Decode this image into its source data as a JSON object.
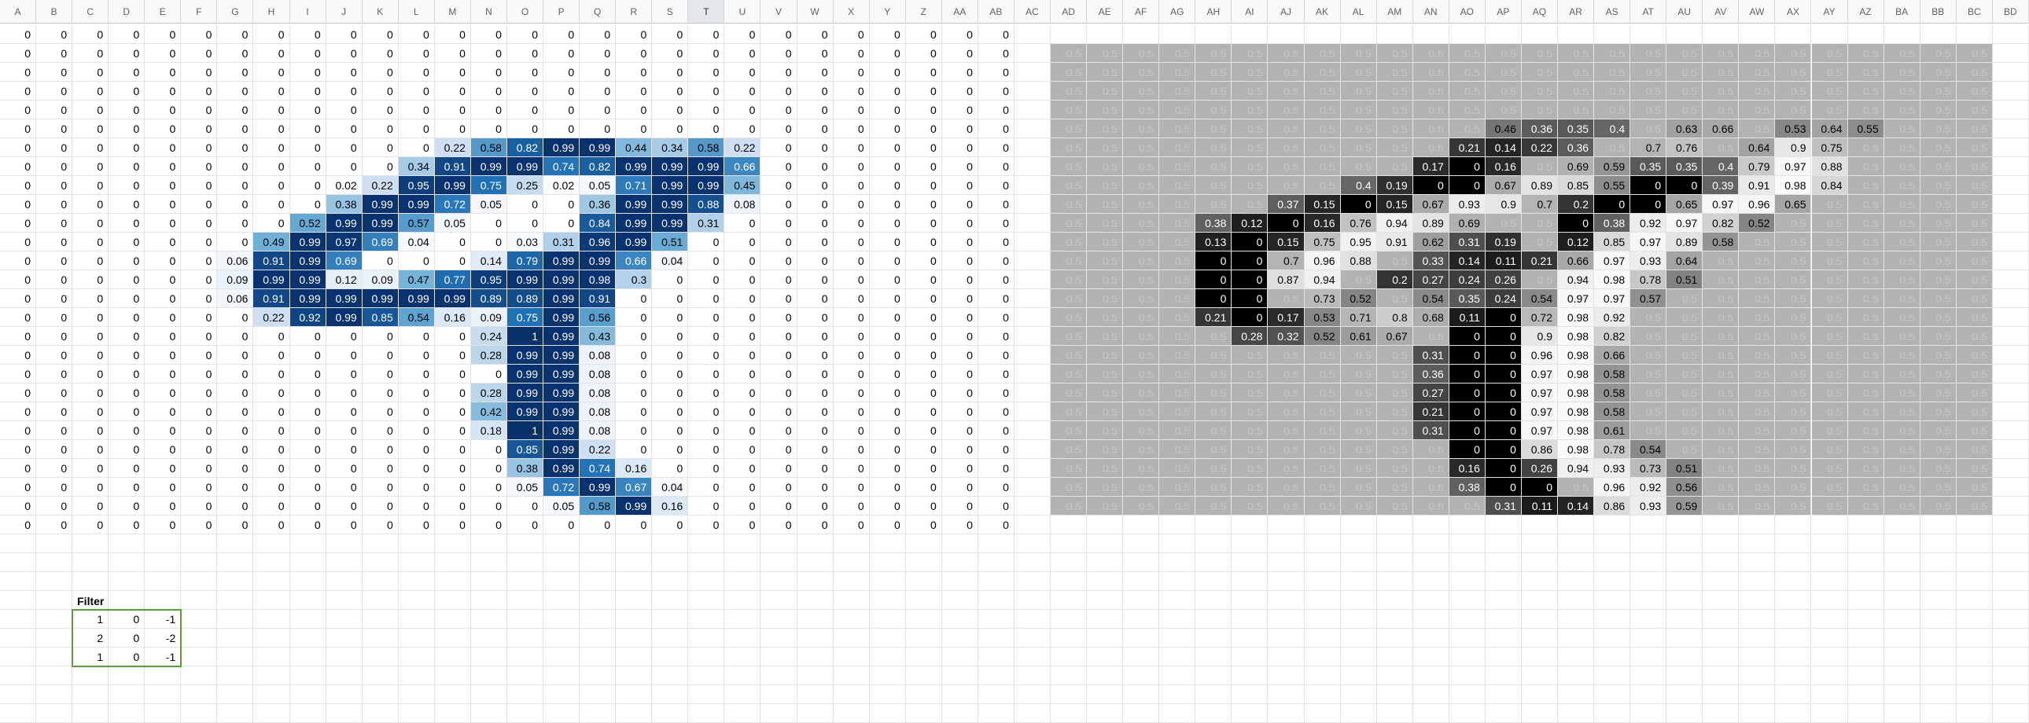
{
  "columns": [
    "A",
    "B",
    "C",
    "D",
    "E",
    "F",
    "G",
    "H",
    "I",
    "J",
    "K",
    "L",
    "M",
    "N",
    "O",
    "P",
    "Q",
    "R",
    "S",
    "T",
    "U",
    "V",
    "W",
    "X",
    "Y",
    "Z",
    "AA",
    "AB",
    "AC",
    "AD",
    "AE",
    "AF",
    "AG",
    "AH",
    "AI",
    "AJ",
    "AK",
    "AL",
    "AM",
    "AN",
    "AO",
    "AP",
    "AQ",
    "AR",
    "AS",
    "AT",
    "AU",
    "AV",
    "AW",
    "AX",
    "AY",
    "AZ",
    "BA",
    "BB",
    "BC",
    "BD"
  ],
  "selected_column": "T",
  "image_rows": [
    [
      0,
      0,
      0,
      0,
      0,
      0,
      0,
      0,
      0,
      0,
      0,
      0,
      0,
      0,
      0,
      0,
      0,
      0,
      0,
      0,
      0,
      0,
      0,
      0,
      0,
      0,
      0,
      0
    ],
    [
      0,
      0,
      0,
      0,
      0,
      0,
      0,
      0,
      0,
      0,
      0,
      0,
      0,
      0,
      0,
      0,
      0,
      0,
      0,
      0,
      0,
      0,
      0,
      0,
      0,
      0,
      0,
      0
    ],
    [
      0,
      0,
      0,
      0,
      0,
      0,
      0,
      0,
      0,
      0,
      0,
      0,
      0,
      0,
      0,
      0,
      0,
      0,
      0,
      0,
      0,
      0,
      0,
      0,
      0,
      0,
      0,
      0
    ],
    [
      0,
      0,
      0,
      0,
      0,
      0,
      0,
      0,
      0,
      0,
      0,
      0,
      0,
      0,
      0,
      0,
      0,
      0,
      0,
      0,
      0,
      0,
      0,
      0,
      0,
      0,
      0,
      0
    ],
    [
      0,
      0,
      0,
      0,
      0,
      0,
      0,
      0,
      0,
      0,
      0,
      0,
      0,
      0,
      0,
      0,
      0,
      0,
      0,
      0,
      0,
      0,
      0,
      0,
      0,
      0,
      0,
      0
    ],
    [
      0,
      0,
      0,
      0,
      0,
      0,
      0,
      0,
      0,
      0,
      0,
      0,
      0,
      0,
      0,
      0,
      0,
      0,
      0,
      0,
      0,
      0,
      0,
      0,
      0,
      0,
      0,
      0
    ],
    [
      0,
      0,
      0,
      0,
      0,
      0,
      0,
      0,
      0,
      0,
      0,
      0,
      0.22,
      0.58,
      0.82,
      0.99,
      0.99,
      0.44,
      0.34,
      0.58,
      0.22,
      0,
      0,
      0,
      0,
      0,
      0,
      0
    ],
    [
      0,
      0,
      0,
      0,
      0,
      0,
      0,
      0,
      0,
      0,
      0,
      0.34,
      0.91,
      0.99,
      0.99,
      0.74,
      0.82,
      0.99,
      0.99,
      0.99,
      0.66,
      0,
      0,
      0,
      0,
      0,
      0,
      0
    ],
    [
      0,
      0,
      0,
      0,
      0,
      0,
      0,
      0,
      0,
      0.02,
      0.22,
      0.95,
      0.99,
      0.75,
      0.25,
      0.02,
      0.05,
      0.71,
      0.99,
      0.99,
      0.45,
      0,
      0,
      0,
      0,
      0,
      0,
      0
    ],
    [
      0,
      0,
      0,
      0,
      0,
      0,
      0,
      0,
      0,
      0.38,
      0.99,
      0.99,
      0.72,
      0.05,
      0,
      0,
      0.36,
      0.99,
      0.99,
      0.88,
      0.08,
      0,
      0,
      0,
      0,
      0,
      0,
      0
    ],
    [
      0,
      0,
      0,
      0,
      0,
      0,
      0,
      0,
      0.52,
      0.99,
      0.99,
      0.57,
      0.05,
      0,
      0,
      0,
      0.84,
      0.99,
      0.99,
      0.31,
      0,
      0,
      0,
      0,
      0,
      0,
      0,
      0
    ],
    [
      0,
      0,
      0,
      0,
      0,
      0,
      0,
      0.49,
      0.99,
      0.97,
      0.69,
      0.04,
      0,
      0,
      0.03,
      0.31,
      0.96,
      0.99,
      0.51,
      0,
      0,
      0,
      0,
      0,
      0,
      0,
      0,
      0
    ],
    [
      0,
      0,
      0,
      0,
      0,
      0,
      0.06,
      0.91,
      0.99,
      0.69,
      0,
      0,
      0,
      0.14,
      0.79,
      0.99,
      0.99,
      0.66,
      0.04,
      0,
      0,
      0,
      0,
      0,
      0,
      0,
      0,
      0
    ],
    [
      0,
      0,
      0,
      0,
      0,
      0,
      0.09,
      0.99,
      0.99,
      0.12,
      0.09,
      0.47,
      0.77,
      0.95,
      0.99,
      0.99,
      0.98,
      0.3,
      0,
      0,
      0,
      0,
      0,
      0,
      0,
      0,
      0,
      0
    ],
    [
      0,
      0,
      0,
      0,
      0,
      0,
      0.06,
      0.91,
      0.99,
      0.99,
      0.99,
      0.99,
      0.99,
      0.89,
      0.89,
      0.99,
      0.91,
      0,
      0,
      0,
      0,
      0,
      0,
      0,
      0,
      0,
      0,
      0
    ],
    [
      0,
      0,
      0,
      0,
      0,
      0,
      0,
      0.22,
      0.92,
      0.99,
      0.85,
      0.54,
      0.16,
      0.09,
      0.75,
      0.99,
      0.56,
      0,
      0,
      0,
      0,
      0,
      0,
      0,
      0,
      0,
      0,
      0
    ],
    [
      0,
      0,
      0,
      0,
      0,
      0,
      0,
      0,
      0,
      0,
      0,
      0,
      0,
      0.24,
      1,
      0.99,
      0.43,
      0,
      0,
      0,
      0,
      0,
      0,
      0,
      0,
      0,
      0,
      0
    ],
    [
      0,
      0,
      0,
      0,
      0,
      0,
      0,
      0,
      0,
      0,
      0,
      0,
      0,
      0.28,
      0.99,
      0.99,
      0.08,
      0,
      0,
      0,
      0,
      0,
      0,
      0,
      0,
      0,
      0,
      0
    ],
    [
      0,
      0,
      0,
      0,
      0,
      0,
      0,
      0,
      0,
      0,
      0,
      0,
      0,
      0,
      0.99,
      0.99,
      0.08,
      0,
      0,
      0,
      0,
      0,
      0,
      0,
      0,
      0,
      0,
      0
    ],
    [
      0,
      0,
      0,
      0,
      0,
      0,
      0,
      0,
      0,
      0,
      0,
      0,
      0,
      0.28,
      0.99,
      0.99,
      0.08,
      0,
      0,
      0,
      0,
      0,
      0,
      0,
      0,
      0,
      0,
      0
    ],
    [
      0,
      0,
      0,
      0,
      0,
      0,
      0,
      0,
      0,
      0,
      0,
      0,
      0,
      0.42,
      0.99,
      0.99,
      0.08,
      0,
      0,
      0,
      0,
      0,
      0,
      0,
      0,
      0,
      0,
      0
    ],
    [
      0,
      0,
      0,
      0,
      0,
      0,
      0,
      0,
      0,
      0,
      0,
      0,
      0,
      0.18,
      1,
      0.99,
      0.08,
      0,
      0,
      0,
      0,
      0,
      0,
      0,
      0,
      0,
      0,
      0
    ],
    [
      0,
      0,
      0,
      0,
      0,
      0,
      0,
      0,
      0,
      0,
      0,
      0,
      0,
      0,
      0.85,
      0.99,
      0.22,
      0,
      0,
      0,
      0,
      0,
      0,
      0,
      0,
      0,
      0,
      0
    ],
    [
      0,
      0,
      0,
      0,
      0,
      0,
      0,
      0,
      0,
      0,
      0,
      0,
      0,
      0,
      0.38,
      0.99,
      0.74,
      0.16,
      0,
      0,
      0,
      0,
      0,
      0,
      0,
      0,
      0,
      0
    ],
    [
      0,
      0,
      0,
      0,
      0,
      0,
      0,
      0,
      0,
      0,
      0,
      0,
      0,
      0,
      0.05,
      0.72,
      0.99,
      0.67,
      0.04,
      0,
      0,
      0,
      0,
      0,
      0,
      0,
      0,
      0
    ],
    [
      0,
      0,
      0,
      0,
      0,
      0,
      0,
      0,
      0,
      0,
      0,
      0,
      0,
      0,
      0,
      0.05,
      0.58,
      0.99,
      0.16,
      0,
      0,
      0,
      0,
      0,
      0,
      0,
      0,
      0
    ],
    [
      0,
      0,
      0,
      0,
      0,
      0,
      0,
      0,
      0,
      0,
      0,
      0,
      0,
      0,
      0,
      0,
      0,
      0,
      0,
      0,
      0,
      0,
      0,
      0,
      0,
      0,
      0,
      0
    ]
  ],
  "conv_rows": [
    [
      0.5,
      0.5,
      0.5,
      0.5,
      0.5,
      0.5,
      0.5,
      0.5,
      0.5,
      0.5,
      0.5,
      0.5,
      0.5,
      0.5,
      0.5,
      0.5,
      0.5,
      0.5,
      0.5,
      0.5,
      0.5,
      0.5,
      0.5,
      0.5,
      0.5,
      0.5
    ],
    [
      0.5,
      0.5,
      0.5,
      0.5,
      0.5,
      0.5,
      0.5,
      0.5,
      0.5,
      0.5,
      0.5,
      0.5,
      0.5,
      0.5,
      0.5,
      0.5,
      0.5,
      0.5,
      0.5,
      0.5,
      0.5,
      0.5,
      0.5,
      0.5,
      0.5,
      0.5
    ],
    [
      0.5,
      0.5,
      0.5,
      0.5,
      0.5,
      0.5,
      0.5,
      0.5,
      0.5,
      0.5,
      0.5,
      0.5,
      0.5,
      0.5,
      0.5,
      0.5,
      0.5,
      0.5,
      0.5,
      0.5,
      0.5,
      0.5,
      0.5,
      0.5,
      0.5,
      0.5
    ],
    [
      0.5,
      0.5,
      0.5,
      0.5,
      0.5,
      0.5,
      0.5,
      0.5,
      0.5,
      0.5,
      0.5,
      0.5,
      0.5,
      0.5,
      0.5,
      0.5,
      0.5,
      0.5,
      0.5,
      0.5,
      0.5,
      0.5,
      0.5,
      0.5,
      0.5,
      0.5
    ],
    [
      0.5,
      0.5,
      0.5,
      0.5,
      0.5,
      0.5,
      0.5,
      0.5,
      0.5,
      0.5,
      0.5,
      0.5,
      0.46,
      0.36,
      0.35,
      0.4,
      0.5,
      0.63,
      0.66,
      0.5,
      0.53,
      0.64,
      0.55,
      0.5,
      0.5,
      0.5
    ],
    [
      0.5,
      0.5,
      0.5,
      0.5,
      0.5,
      0.5,
      0.5,
      0.5,
      0.5,
      0.5,
      0.5,
      0.21,
      0.14,
      0.22,
      0.36,
      0.5,
      0.7,
      0.76,
      0.5,
      0.64,
      0.9,
      0.75,
      0.5,
      0.5,
      0.5,
      0.5
    ],
    [
      0.5,
      0.5,
      0.5,
      0.5,
      0.5,
      0.5,
      0.5,
      0.5,
      0.5,
      0.5,
      0.17,
      0,
      0.16,
      0.5,
      0.69,
      0.59,
      0.35,
      0.35,
      0.4,
      0.79,
      0.97,
      0.88,
      0.5,
      0.5,
      0.5,
      0.5
    ],
    [
      0.5,
      0.5,
      0.5,
      0.5,
      0.5,
      0.5,
      0.5,
      0.5,
      0.4,
      0.19,
      0,
      0,
      0.67,
      0.89,
      0.85,
      0.55,
      0,
      0,
      0.39,
      0.91,
      0.98,
      0.84,
      0.5,
      0.5,
      0.5,
      0.5
    ],
    [
      0.5,
      0.5,
      0.5,
      0.5,
      0.5,
      0.5,
      0.37,
      0.15,
      0,
      0.15,
      0.67,
      0.93,
      0.9,
      0.7,
      0.2,
      0,
      0,
      0.65,
      0.97,
      0.96,
      0.65,
      0.5,
      0.5,
      0.5,
      0.5,
      0.5
    ],
    [
      0.5,
      0.5,
      0.5,
      0.5,
      0.38,
      0.12,
      0,
      0.16,
      0.76,
      0.94,
      0.89,
      0.69,
      0.5,
      0.5,
      0,
      0.38,
      0.92,
      0.97,
      0.82,
      0.52,
      0.5,
      0.5,
      0.5,
      0.5,
      0.5,
      0.5
    ],
    [
      0.5,
      0.5,
      0.5,
      0.5,
      0.13,
      0,
      0.15,
      0.75,
      0.95,
      0.91,
      0.62,
      0.31,
      0.19,
      0.5,
      0.12,
      0.85,
      0.97,
      0.89,
      0.58,
      0.5,
      0.5,
      0.5,
      0.5,
      0.5,
      0.5,
      0.5
    ],
    [
      0.5,
      0.5,
      0.5,
      0.5,
      0,
      0,
      0.7,
      0.96,
      0.88,
      0.5,
      0.33,
      0.14,
      0.11,
      0.21,
      0.66,
      0.97,
      0.93,
      0.64,
      0.5,
      0.5,
      0.5,
      0.5,
      0.5,
      0.5,
      0.5,
      0.5
    ],
    [
      0.5,
      0.5,
      0.5,
      0.5,
      0,
      0,
      0.87,
      0.94,
      0.5,
      0.2,
      0.27,
      0.24,
      0.26,
      0.5,
      0.94,
      0.98,
      0.78,
      0.51,
      0.5,
      0.5,
      0.5,
      0.5,
      0.5,
      0.5,
      0.5,
      0.5
    ],
    [
      0.5,
      0.5,
      0.5,
      0.5,
      0,
      0,
      0.5,
      0.73,
      0.52,
      0.5,
      0.54,
      0.35,
      0.24,
      0.54,
      0.97,
      0.97,
      0.57,
      0.5,
      0.5,
      0.5,
      0.5,
      0.5,
      0.5,
      0.5,
      0.5,
      0.5
    ],
    [
      0.5,
      0.5,
      0.5,
      0.5,
      0.21,
      0,
      0.17,
      0.53,
      0.71,
      0.8,
      0.68,
      0.11,
      0,
      0.72,
      0.98,
      0.92,
      0.5,
      0.5,
      0.5,
      0.5,
      0.5,
      0.5,
      0.5,
      0.5,
      0.5,
      0.5
    ],
    [
      0.5,
      0.5,
      0.5,
      0.5,
      0.5,
      0.28,
      0.32,
      0.52,
      0.61,
      0.67,
      0.5,
      0,
      0,
      0.9,
      0.98,
      0.82,
      0.5,
      0.5,
      0.5,
      0.5,
      0.5,
      0.5,
      0.5,
      0.5,
      0.5,
      0.5
    ],
    [
      0.5,
      0.5,
      0.5,
      0.5,
      0.5,
      0.5,
      0.5,
      0.5,
      0.5,
      0.5,
      0.31,
      0,
      0,
      0.96,
      0.98,
      0.66,
      0.5,
      0.5,
      0.5,
      0.5,
      0.5,
      0.5,
      0.5,
      0.5,
      0.5,
      0.5
    ],
    [
      0.5,
      0.5,
      0.5,
      0.5,
      0.5,
      0.5,
      0.5,
      0.5,
      0.5,
      0.5,
      0.36,
      0,
      0,
      0.97,
      0.98,
      0.58,
      0.5,
      0.5,
      0.5,
      0.5,
      0.5,
      0.5,
      0.5,
      0.5,
      0.5,
      0.5
    ],
    [
      0.5,
      0.5,
      0.5,
      0.5,
      0.5,
      0.5,
      0.5,
      0.5,
      0.5,
      0.5,
      0.27,
      0,
      0,
      0.97,
      0.98,
      0.58,
      0.5,
      0.5,
      0.5,
      0.5,
      0.5,
      0.5,
      0.5,
      0.5,
      0.5,
      0.5
    ],
    [
      0.5,
      0.5,
      0.5,
      0.5,
      0.5,
      0.5,
      0.5,
      0.5,
      0.5,
      0.5,
      0.21,
      0,
      0,
      0.97,
      0.98,
      0.58,
      0.5,
      0.5,
      0.5,
      0.5,
      0.5,
      0.5,
      0.5,
      0.5,
      0.5,
      0.5
    ],
    [
      0.5,
      0.5,
      0.5,
      0.5,
      0.5,
      0.5,
      0.5,
      0.5,
      0.5,
      0.5,
      0.31,
      0,
      0,
      0.97,
      0.98,
      0.61,
      0.5,
      0.5,
      0.5,
      0.5,
      0.5,
      0.5,
      0.5,
      0.5,
      0.5,
      0.5
    ],
    [
      0.5,
      0.5,
      0.5,
      0.5,
      0.5,
      0.5,
      0.5,
      0.5,
      0.5,
      0.5,
      0.5,
      0,
      0,
      0.86,
      0.98,
      0.78,
      0.54,
      0.5,
      0.5,
      0.5,
      0.5,
      0.5,
      0.5,
      0.5,
      0.5,
      0.5
    ],
    [
      0.5,
      0.5,
      0.5,
      0.5,
      0.5,
      0.5,
      0.5,
      0.5,
      0.5,
      0.5,
      0.5,
      0.16,
      0,
      0.26,
      0.94,
      0.93,
      0.73,
      0.51,
      0.5,
      0.5,
      0.5,
      0.5,
      0.5,
      0.5,
      0.5,
      0.5
    ],
    [
      0.5,
      0.5,
      0.5,
      0.5,
      0.5,
      0.5,
      0.5,
      0.5,
      0.5,
      0.5,
      0.5,
      0.38,
      0,
      0,
      0.5,
      0.96,
      0.92,
      0.56,
      0.5,
      0.5,
      0.5,
      0.5,
      0.5,
      0.5,
      0.5,
      0.5
    ],
    [
      0.5,
      0.5,
      0.5,
      0.5,
      0.5,
      0.5,
      0.5,
      0.5,
      0.5,
      0.5,
      0.5,
      0.5,
      0.31,
      0.11,
      0.14,
      0.86,
      0.93,
      0.59,
      0.5,
      0.5,
      0.5,
      0.5,
      0.5,
      0.5,
      0.5,
      0.5
    ]
  ],
  "filter": {
    "title": "Filter",
    "rows": [
      [
        1,
        0,
        -1
      ],
      [
        2,
        0,
        -2
      ],
      [
        1,
        0,
        -1
      ]
    ]
  },
  "colors": {
    "image_low": "#ffffff",
    "image_high": "#08306b",
    "conv_low": "#000000",
    "conv_high": "#ffffff",
    "filter_border": "#5b9a3a"
  }
}
